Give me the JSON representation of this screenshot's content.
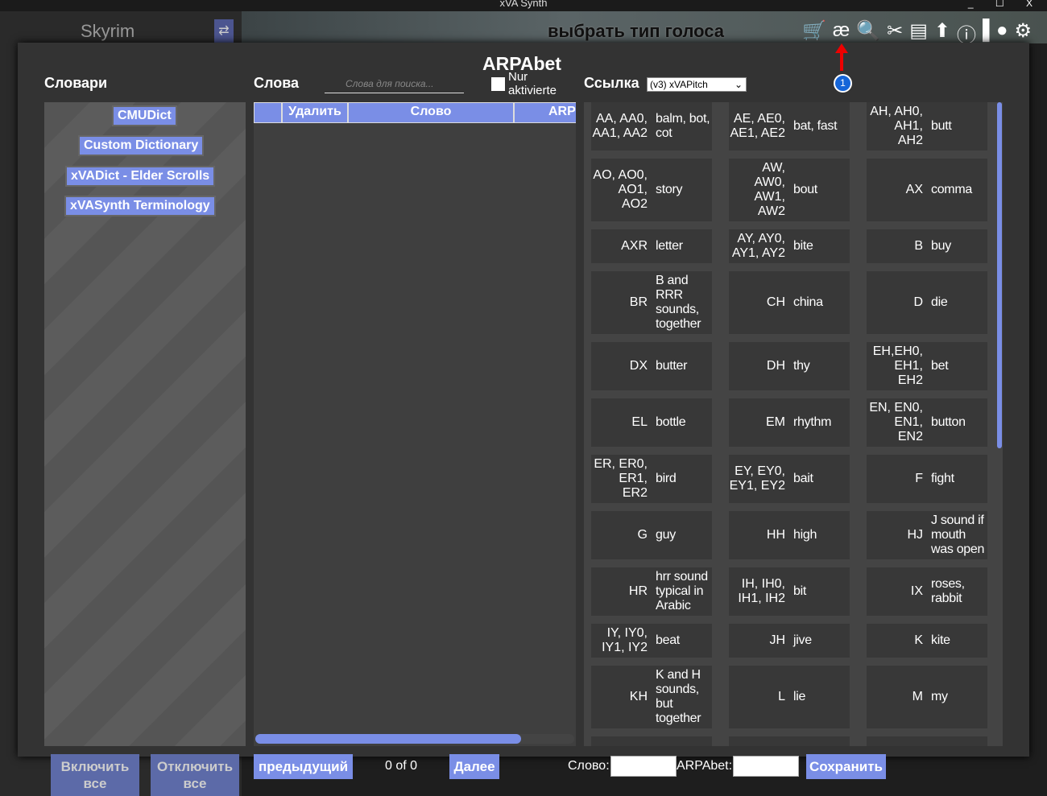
{
  "window": {
    "title": "xVA Synth",
    "controls": "_ ☐ X"
  },
  "app": {
    "game": "Skyrim",
    "swap_icon": "⇄",
    "voice_title": "выбрать тип голоса",
    "toolbar": [
      "🛒",
      "æ",
      "🔍",
      "✂",
      "▤",
      "⬆",
      "ⓘ",
      "▌●",
      "⚙"
    ],
    "badge": "1"
  },
  "modal": {
    "title": "ARPAbet",
    "dictionaries_heading": "Словари",
    "words_heading": "Слова",
    "search_placeholder": "Слова для поиска...",
    "only_active_label": "Nur aktivierte",
    "reference_heading": "Ссылка",
    "reference_select": "(v3) xVAPitch",
    "dictionaries": [
      "CMUDict",
      "Custom Dictionary",
      "xVADict - Elder Scrolls",
      "xVASynth Terminology"
    ],
    "columns": [
      "",
      "Удалить",
      "Слово",
      "ARP"
    ],
    "reference": [
      [
        "AA, AA0, AA1, AA2",
        "balm, bot, cot"
      ],
      [
        "AE, AE0, AE1, AE2",
        "bat, fast"
      ],
      [
        "AH, AH0, AH1, AH2",
        "butt"
      ],
      [
        "AO, AO0, AO1, AO2",
        "story"
      ],
      [
        "AW, AW0, AW1, AW2",
        "bout"
      ],
      [
        "AX",
        "comma"
      ],
      [
        "AXR",
        "letter"
      ],
      [
        "AY, AY0, AY1, AY2",
        "bite"
      ],
      [
        "B",
        "buy"
      ],
      [
        "BR",
        "B and RRR sounds, together"
      ],
      [
        "CH",
        "china"
      ],
      [
        "D",
        "die"
      ],
      [
        "DX",
        "butter"
      ],
      [
        "DH",
        "thy"
      ],
      [
        "EH,EH0, EH1, EH2",
        "bet"
      ],
      [
        "EL",
        "bottle"
      ],
      [
        "EM",
        "rhythm"
      ],
      [
        "EN, EN0, EN1, EN2",
        "button"
      ],
      [
        "ER, ER0, ER1, ER2",
        "bird"
      ],
      [
        "EY, EY0, EY1, EY2",
        "bait"
      ],
      [
        "F",
        "fight"
      ],
      [
        "G",
        "guy"
      ],
      [
        "HH",
        "high"
      ],
      [
        "HJ",
        "J sound if mouth was open"
      ],
      [
        "HR",
        "hrr sound typical in Arabic"
      ],
      [
        "IH, IH0, IH1, IH2",
        "bit"
      ],
      [
        "IX",
        "roses, rabbit"
      ],
      [
        "IY, IY0, IY1, IY2",
        "beat"
      ],
      [
        "JH",
        "jive"
      ],
      [
        "K",
        "kite"
      ],
      [
        "KH",
        "K and H sounds, but together"
      ],
      [
        "L",
        "lie"
      ],
      [
        "M",
        "my"
      ]
    ],
    "enable_all": "Включить все",
    "disable_all": "Отключить все",
    "prev": "предыдущий",
    "page": "0 of 0",
    "next": "Далее",
    "word_label": "Слово:",
    "arpabet_label": "ARPAbet:",
    "save": "Сохранить"
  }
}
